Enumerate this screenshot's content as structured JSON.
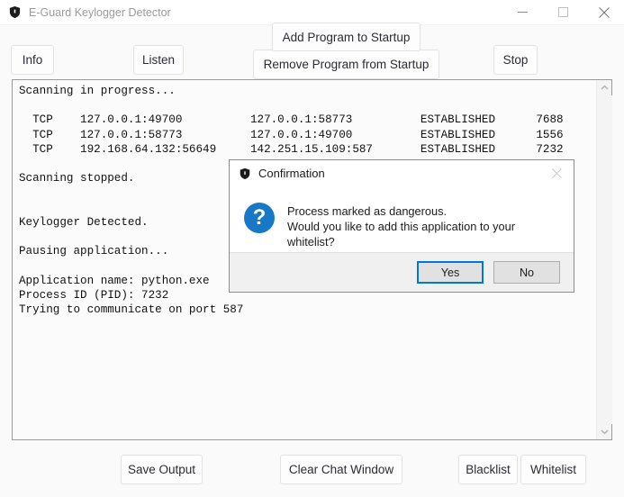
{
  "window": {
    "title": "E-Guard Keylogger Detector",
    "icon": "shield-icon",
    "controls": {
      "minimize": "minimize-icon",
      "maximize": "maximize-icon",
      "close": "close-icon"
    }
  },
  "toolbar": {
    "info_label": "Info",
    "listen_label": "Listen",
    "add_startup_label": "Add Program to Startup",
    "remove_startup_label": "Remove Program from Startup",
    "stop_label": "Stop"
  },
  "console": {
    "text": "Scanning in progress...\n\n  TCP    127.0.0.1:49700          127.0.0.1:58773          ESTABLISHED      7688\n  TCP    127.0.0.1:58773          127.0.0.1:49700          ESTABLISHED      1556\n  TCP    192.168.64.132:56649     142.251.15.109:587       ESTABLISHED      7232\n\nScanning stopped.\n\n\nKeylogger Detected.\n\nPausing application...\n\nApplication name: python.exe\nProcess ID (PID): 7232\nTrying to communicate on port 587",
    "scrollbar": {
      "up_arrow": "chevron-up-icon",
      "down_arrow": "chevron-down-icon"
    }
  },
  "footer": {
    "save_output_label": "Save Output",
    "clear_chat_label": "Clear Chat Window",
    "blacklist_label": "Blacklist",
    "whitelist_label": "Whitelist"
  },
  "dialog": {
    "title": "Confirmation",
    "icon": "shield-icon",
    "close_icon": "close-icon",
    "question_icon": "question-mark-icon",
    "message_line1": "Process marked as dangerous.",
    "message_line2": "Would you like to add this application to your whitelist?",
    "yes_label": "Yes",
    "no_label": "No"
  },
  "colors": {
    "accent": "#0078d7",
    "dialog_icon_blue": "#1878c8",
    "window_bg": "#fafafa",
    "console_bg": "#fbfbfb",
    "dialog_footer_bg": "#f0f0f0"
  }
}
